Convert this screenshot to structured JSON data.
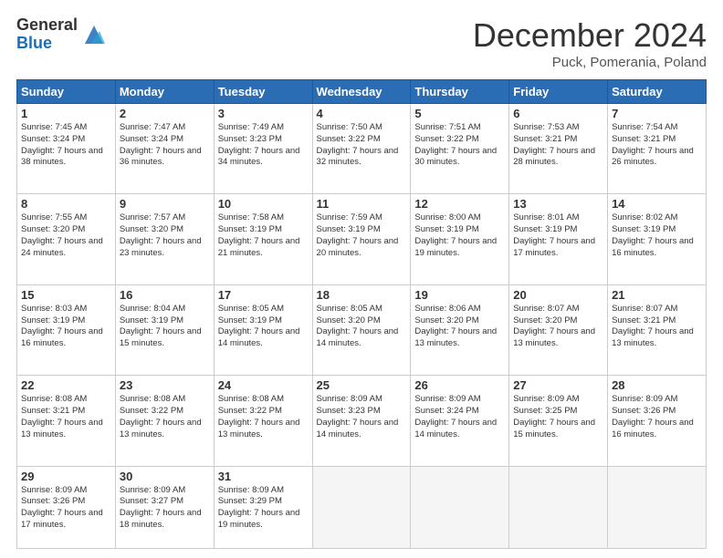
{
  "logo": {
    "general": "General",
    "blue": "Blue"
  },
  "title": "December 2024",
  "subtitle": "Puck, Pomerania, Poland",
  "weekdays": [
    "Sunday",
    "Monday",
    "Tuesday",
    "Wednesday",
    "Thursday",
    "Friday",
    "Saturday"
  ],
  "weeks": [
    [
      {
        "day": "1",
        "sunrise": "7:45 AM",
        "sunset": "3:24 PM",
        "daylight": "7 hours and 38 minutes."
      },
      {
        "day": "2",
        "sunrise": "7:47 AM",
        "sunset": "3:24 PM",
        "daylight": "7 hours and 36 minutes."
      },
      {
        "day": "3",
        "sunrise": "7:49 AM",
        "sunset": "3:23 PM",
        "daylight": "7 hours and 34 minutes."
      },
      {
        "day": "4",
        "sunrise": "7:50 AM",
        "sunset": "3:22 PM",
        "daylight": "7 hours and 32 minutes."
      },
      {
        "day": "5",
        "sunrise": "7:51 AM",
        "sunset": "3:22 PM",
        "daylight": "7 hours and 30 minutes."
      },
      {
        "day": "6",
        "sunrise": "7:53 AM",
        "sunset": "3:21 PM",
        "daylight": "7 hours and 28 minutes."
      },
      {
        "day": "7",
        "sunrise": "7:54 AM",
        "sunset": "3:21 PM",
        "daylight": "7 hours and 26 minutes."
      }
    ],
    [
      {
        "day": "8",
        "sunrise": "7:55 AM",
        "sunset": "3:20 PM",
        "daylight": "7 hours and 24 minutes."
      },
      {
        "day": "9",
        "sunrise": "7:57 AM",
        "sunset": "3:20 PM",
        "daylight": "7 hours and 23 minutes."
      },
      {
        "day": "10",
        "sunrise": "7:58 AM",
        "sunset": "3:19 PM",
        "daylight": "7 hours and 21 minutes."
      },
      {
        "day": "11",
        "sunrise": "7:59 AM",
        "sunset": "3:19 PM",
        "daylight": "7 hours and 20 minutes."
      },
      {
        "day": "12",
        "sunrise": "8:00 AM",
        "sunset": "3:19 PM",
        "daylight": "7 hours and 19 minutes."
      },
      {
        "day": "13",
        "sunrise": "8:01 AM",
        "sunset": "3:19 PM",
        "daylight": "7 hours and 17 minutes."
      },
      {
        "day": "14",
        "sunrise": "8:02 AM",
        "sunset": "3:19 PM",
        "daylight": "7 hours and 16 minutes."
      }
    ],
    [
      {
        "day": "15",
        "sunrise": "8:03 AM",
        "sunset": "3:19 PM",
        "daylight": "7 hours and 16 minutes."
      },
      {
        "day": "16",
        "sunrise": "8:04 AM",
        "sunset": "3:19 PM",
        "daylight": "7 hours and 15 minutes."
      },
      {
        "day": "17",
        "sunrise": "8:05 AM",
        "sunset": "3:19 PM",
        "daylight": "7 hours and 14 minutes."
      },
      {
        "day": "18",
        "sunrise": "8:05 AM",
        "sunset": "3:20 PM",
        "daylight": "7 hours and 14 minutes."
      },
      {
        "day": "19",
        "sunrise": "8:06 AM",
        "sunset": "3:20 PM",
        "daylight": "7 hours and 13 minutes."
      },
      {
        "day": "20",
        "sunrise": "8:07 AM",
        "sunset": "3:20 PM",
        "daylight": "7 hours and 13 minutes."
      },
      {
        "day": "21",
        "sunrise": "8:07 AM",
        "sunset": "3:21 PM",
        "daylight": "7 hours and 13 minutes."
      }
    ],
    [
      {
        "day": "22",
        "sunrise": "8:08 AM",
        "sunset": "3:21 PM",
        "daylight": "7 hours and 13 minutes."
      },
      {
        "day": "23",
        "sunrise": "8:08 AM",
        "sunset": "3:22 PM",
        "daylight": "7 hours and 13 minutes."
      },
      {
        "day": "24",
        "sunrise": "8:08 AM",
        "sunset": "3:22 PM",
        "daylight": "7 hours and 13 minutes."
      },
      {
        "day": "25",
        "sunrise": "8:09 AM",
        "sunset": "3:23 PM",
        "daylight": "7 hours and 14 minutes."
      },
      {
        "day": "26",
        "sunrise": "8:09 AM",
        "sunset": "3:24 PM",
        "daylight": "7 hours and 14 minutes."
      },
      {
        "day": "27",
        "sunrise": "8:09 AM",
        "sunset": "3:25 PM",
        "daylight": "7 hours and 15 minutes."
      },
      {
        "day": "28",
        "sunrise": "8:09 AM",
        "sunset": "3:26 PM",
        "daylight": "7 hours and 16 minutes."
      }
    ],
    [
      {
        "day": "29",
        "sunrise": "8:09 AM",
        "sunset": "3:26 PM",
        "daylight": "7 hours and 17 minutes."
      },
      {
        "day": "30",
        "sunrise": "8:09 AM",
        "sunset": "3:27 PM",
        "daylight": "7 hours and 18 minutes."
      },
      {
        "day": "31",
        "sunrise": "8:09 AM",
        "sunset": "3:29 PM",
        "daylight": "7 hours and 19 minutes."
      },
      null,
      null,
      null,
      null
    ]
  ],
  "labels": {
    "sunrise": "Sunrise:",
    "sunset": "Sunset:",
    "daylight": "Daylight:"
  }
}
